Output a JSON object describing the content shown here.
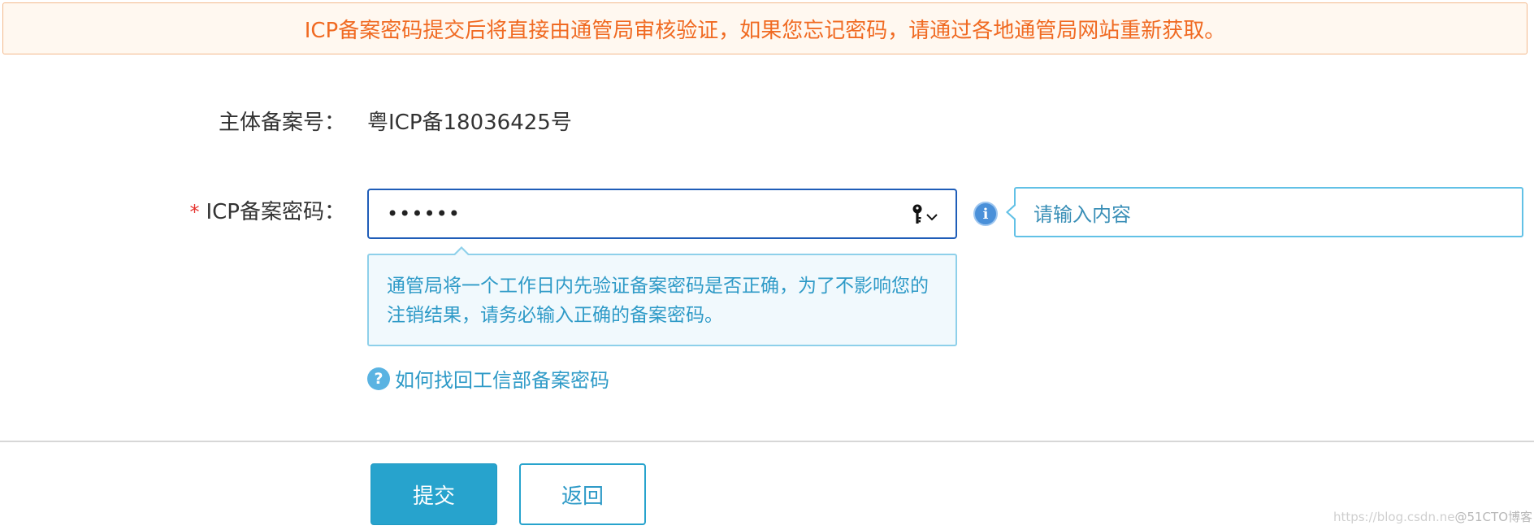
{
  "notice": {
    "text": "ICP备案密码提交后将直接由通管局审核验证，如果您忘记密码，请通过各地通管局网站重新获取。"
  },
  "form": {
    "record_number": {
      "label": "主体备案号：",
      "value": "粤ICP备18036425号"
    },
    "password": {
      "required_mark": "*",
      "label": "ICP备案密码：",
      "value": "••••••",
      "key_icon": "key-icon",
      "dropdown_icon": "chevron-down-icon"
    },
    "side_field": {
      "info_icon": "info-icon",
      "info_glyph": "i",
      "placeholder": "请输入内容"
    },
    "tip": {
      "text": "通管局将一个工作日内先验证备案密码是否正确，为了不影响您的注销结果，请务必输入正确的备案密码。"
    },
    "help_link": {
      "icon": "help-icon",
      "icon_glyph": "?",
      "text": "如何找回工信部备案密码"
    }
  },
  "actions": {
    "submit_label": "提交",
    "back_label": "返回"
  },
  "watermark": {
    "url": "https://blog.csdn.ne",
    "brand": "@51CTO博客"
  },
  "colors": {
    "notice_text": "#f06a22",
    "notice_border": "#f3b98c",
    "primary": "#27a3cd",
    "focus_border": "#1f5db8",
    "link": "#2e9ac7",
    "required": "#e5322d"
  }
}
